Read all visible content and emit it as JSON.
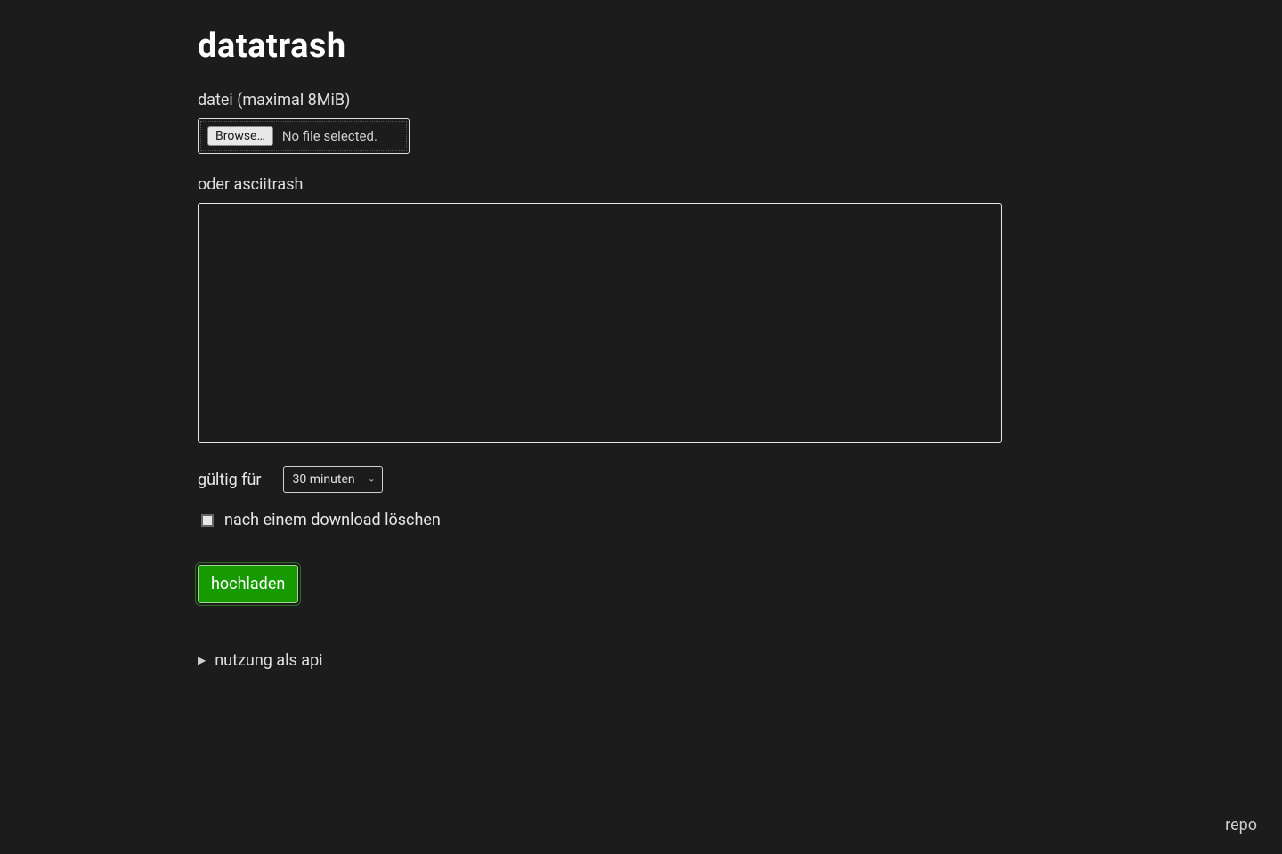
{
  "page": {
    "title": "datatrash"
  },
  "form": {
    "file_label": "datei (maximal 8MiB)",
    "browse_button": "Browse…",
    "file_status": "No file selected.",
    "text_label": "oder asciitrash",
    "text_value": "",
    "validity_label": "gültig für",
    "validity_selected": "30 minuten",
    "delete_checkbox_label": "nach einem download löschen",
    "submit_label": "hochladen"
  },
  "api": {
    "summary_label": "nutzung als api"
  },
  "footer": {
    "repo_label": "repo"
  }
}
